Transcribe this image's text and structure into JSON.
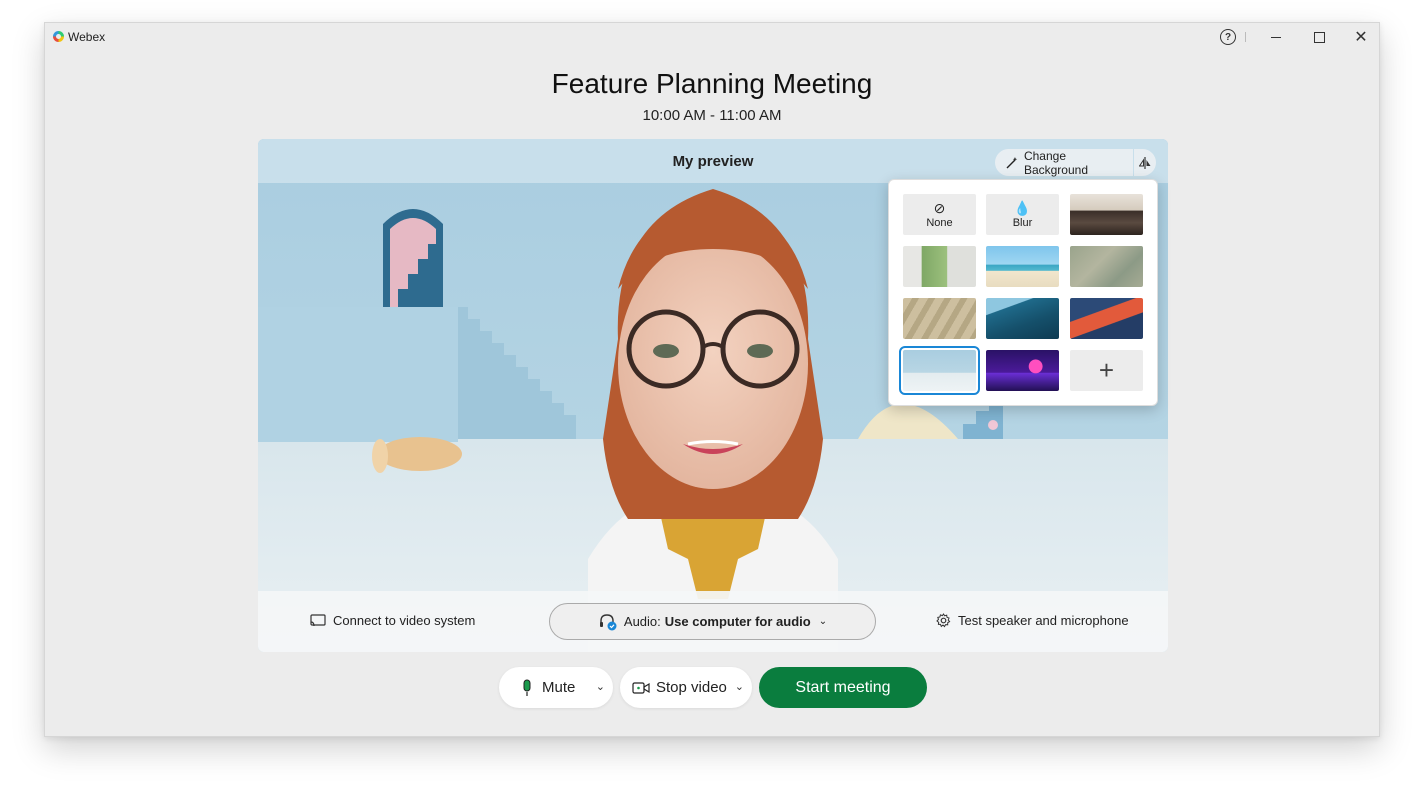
{
  "window": {
    "app_title": "Webex"
  },
  "meeting": {
    "title": "Feature Planning Meeting",
    "time": "10:00 AM - 11:00 AM"
  },
  "preview": {
    "label": "My preview",
    "change_background_label": "Change Background"
  },
  "background_panel": {
    "none_label": "None",
    "blur_label": "Blur",
    "thumbnails": [
      "living-room",
      "office-window",
      "beach",
      "blurred-room",
      "shadows",
      "blue-mountains",
      "red-abstract",
      "blue-staircase",
      "purple-neon"
    ],
    "selected": "blue-staircase"
  },
  "bottom_bar": {
    "connect_label": "Connect to video system",
    "audio_prefix": "Audio:",
    "audio_value": "Use computer for audio",
    "test_label": "Test speaker and microphone"
  },
  "controls": {
    "mute_label": "Mute",
    "video_label": "Stop video",
    "start_label": "Start meeting"
  },
  "colors": {
    "accent_green": "#0a7d3e",
    "selection_blue": "#1a87d6"
  }
}
